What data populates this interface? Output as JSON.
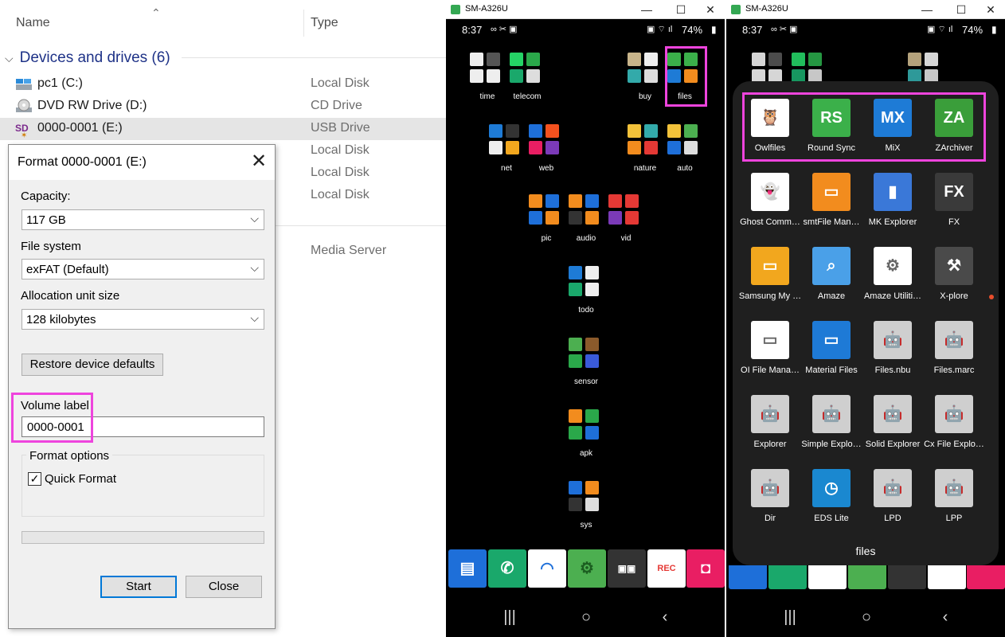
{
  "explorer": {
    "columns": {
      "name": "Name",
      "type": "Type"
    },
    "group": {
      "label": "Devices and drives (6)"
    },
    "drives": [
      {
        "name": "pc1 (C:)",
        "type": "Local Disk",
        "icon": "hard-drive-icon"
      },
      {
        "name": "DVD RW Drive (D:)",
        "type": "CD Drive",
        "icon": "dvd-drive-icon"
      },
      {
        "name": "0000-0001 (E:)",
        "type": "USB Drive",
        "icon": "sd-card-icon"
      }
    ],
    "hidden_types": [
      "Local Disk",
      "Local Disk",
      "Local Disk"
    ],
    "media_type": "Media Server"
  },
  "format_dialog": {
    "title": "Format 0000-0001 (E:)",
    "capacity_label": "Capacity:",
    "capacity_value": "117 GB",
    "fs_label": "File system",
    "fs_value": "exFAT (Default)",
    "alloc_label": "Allocation unit size",
    "alloc_value": "128 kilobytes",
    "restore_label": "Restore device defaults",
    "volume_label": "Volume label",
    "volume_value": "0000-0001",
    "options_label": "Format options",
    "quick_format_label": "Quick Format",
    "quick_format_checked": true,
    "start_label": "Start",
    "close_label": "Close",
    "highlight_color": "#ee44dd"
  },
  "phone_common": {
    "window_title": "SM-A326U",
    "time": "8:37",
    "battery": "74%"
  },
  "phone_home": {
    "folders": [
      {
        "label": "time"
      },
      {
        "label": "telecom"
      },
      {
        "label": "buy"
      },
      {
        "label": "files"
      },
      {
        "label": "net"
      },
      {
        "label": "web"
      },
      {
        "label": "nature"
      },
      {
        "label": "auto"
      },
      {
        "label": "pic"
      },
      {
        "label": "audio"
      },
      {
        "label": "vid"
      },
      {
        "label": "todo"
      },
      {
        "label": "sensor"
      },
      {
        "label": "apk"
      },
      {
        "label": "sys"
      }
    ]
  },
  "phone_drawer": {
    "title": "files",
    "apps": [
      {
        "name": "Owlfiles",
        "icon": "owl-icon",
        "color": "#ffffff",
        "glyph": "🦉"
      },
      {
        "name": "Round Sync",
        "icon": "round-sync-icon",
        "color": "#3bb04a",
        "glyph": "RS"
      },
      {
        "name": "MiX",
        "icon": "mix-icon",
        "color": "#1e7bd6",
        "glyph": "MX"
      },
      {
        "name": "ZArchiver",
        "icon": "zarchiver-icon",
        "color": "#3a9e3a",
        "glyph": "ZA"
      },
      {
        "name": "Ghost Comm…",
        "icon": "ghost-commander-icon",
        "color": "#ffffff",
        "glyph": "👻"
      },
      {
        "name": "smtFile Man…",
        "icon": "folder-orange-icon",
        "color": "#f28c1e",
        "glyph": "▭"
      },
      {
        "name": "MK Explorer",
        "icon": "book-icon",
        "color": "#3a78d8",
        "glyph": "▮"
      },
      {
        "name": "FX",
        "icon": "fx-icon",
        "color": "#3a3a3a",
        "glyph": "FX"
      },
      {
        "name": "Samsung My …",
        "icon": "samsung-folder-icon",
        "color": "#f2a71e",
        "glyph": "▭"
      },
      {
        "name": "Amaze",
        "icon": "amaze-icon",
        "color": "#4aa0e8",
        "glyph": "⌕"
      },
      {
        "name": "Amaze Utiliti…",
        "icon": "amaze-utilities-icon",
        "color": "#ffffff",
        "glyph": "⚙"
      },
      {
        "name": "X-plore",
        "icon": "xplore-icon",
        "color": "#4a4a4a",
        "glyph": "⚒"
      },
      {
        "name": "OI File Mana…",
        "icon": "oi-folder-icon",
        "color": "#ffffff",
        "glyph": "▭"
      },
      {
        "name": "Material Files",
        "icon": "material-folder-icon",
        "color": "#1e7ad6",
        "glyph": "▭"
      },
      {
        "name": "Files.nbu",
        "icon": "android-default-icon",
        "color": "#cfcfcf",
        "glyph": "🤖"
      },
      {
        "name": "Files.marc",
        "icon": "android-default-icon",
        "color": "#cfcfcf",
        "glyph": "🤖"
      },
      {
        "name": "Explorer",
        "icon": "android-default-icon",
        "color": "#cfcfcf",
        "glyph": "🤖"
      },
      {
        "name": "Simple Explo…",
        "icon": "android-default-icon",
        "color": "#cfcfcf",
        "glyph": "🤖"
      },
      {
        "name": "Solid Explorer",
        "icon": "android-default-icon",
        "color": "#cfcfcf",
        "glyph": "🤖"
      },
      {
        "name": "Cx File Explo…",
        "icon": "android-default-icon",
        "color": "#cfcfcf",
        "glyph": "🤖"
      },
      {
        "name": "Dir",
        "icon": "android-default-icon",
        "color": "#cfcfcf",
        "glyph": "🤖"
      },
      {
        "name": "EDS Lite",
        "icon": "eds-clock-icon",
        "color": "#1a88d0",
        "glyph": "◷"
      },
      {
        "name": "LPD",
        "icon": "android-default-icon",
        "color": "#cfcfcf",
        "glyph": "🤖"
      },
      {
        "name": "LPP",
        "icon": "android-default-icon",
        "color": "#cfcfcf",
        "glyph": "🤖"
      }
    ]
  }
}
